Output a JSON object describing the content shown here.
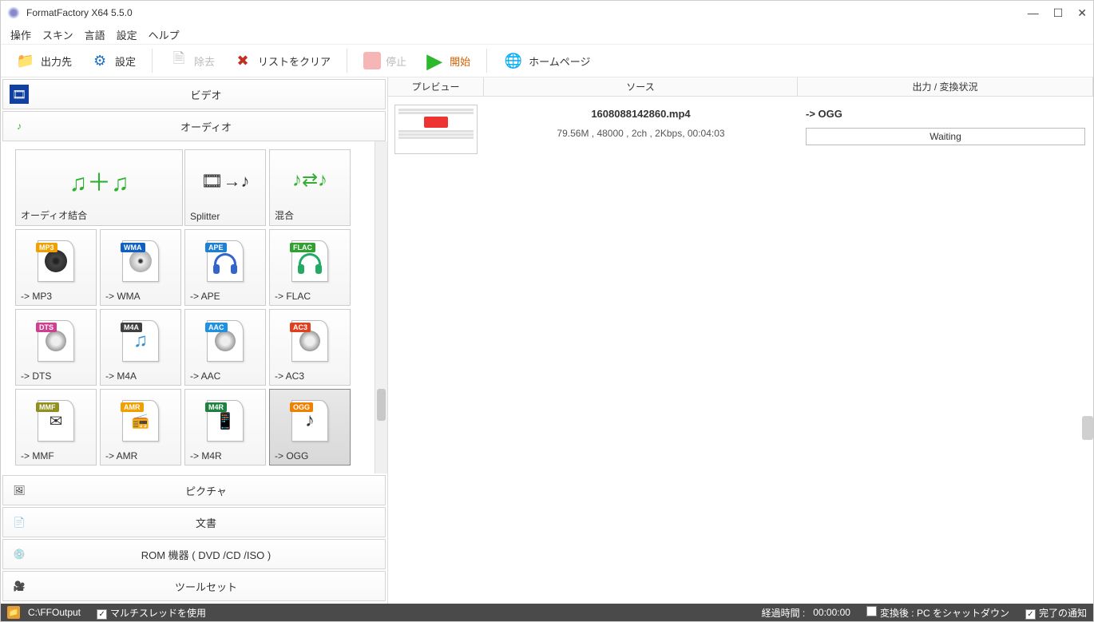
{
  "window": {
    "title": "FormatFactory X64 5.5.0"
  },
  "menu": [
    "操作",
    "スキン",
    "言語",
    "設定",
    "ヘルプ"
  ],
  "toolbar": {
    "output": "出力先",
    "settings": "設定",
    "remove": "除去",
    "clear": "リストをクリア",
    "stop": "停止",
    "start": "開始",
    "home": "ホームページ"
  },
  "categories": {
    "video": "ビデオ",
    "audio": "オーディオ",
    "picture": "ピクチャ",
    "document": "文書",
    "rom": "ROM 機器 ( DVD /CD /ISO )",
    "toolset": "ツールセット"
  },
  "audio_tools": {
    "join": "オーディオ結合",
    "splitter": "Splitter",
    "mix": "混合"
  },
  "formats": {
    "mp3": {
      "tag": "MP3",
      "label": "-> MP3",
      "color": "#f0a000"
    },
    "wma": {
      "tag": "WMA",
      "label": "-> WMA",
      "color": "#1060c0"
    },
    "ape": {
      "tag": "APE",
      "label": "-> APE",
      "color": "#2080d0"
    },
    "flac": {
      "tag": "FLAC",
      "label": "-> FLAC",
      "color": "#30a030"
    },
    "dts": {
      "tag": "DTS",
      "label": "-> DTS",
      "color": "#d04090"
    },
    "m4a": {
      "tag": "M4A",
      "label": "-> M4A",
      "color": "#404040"
    },
    "aac": {
      "tag": "AAC",
      "label": "-> AAC",
      "color": "#2090e0"
    },
    "ac3": {
      "tag": "AC3",
      "label": "-> AC3",
      "color": "#e04020"
    },
    "mmf": {
      "tag": "MMF",
      "label": "-> MMF",
      "color": "#909020"
    },
    "amr": {
      "tag": "AMR",
      "label": "-> AMR",
      "color": "#f0a000"
    },
    "m4r": {
      "tag": "M4R",
      "label": "-> M4R",
      "color": "#208040"
    },
    "ogg": {
      "tag": "OGG",
      "label": "-> OGG",
      "color": "#f08000"
    }
  },
  "list": {
    "cols": {
      "preview": "プレビュー",
      "source": "ソース",
      "status": "出力 / 変換状況"
    },
    "item": {
      "name": "1608088142860.mp4",
      "meta": "79.56M , 48000 , 2ch , 2Kbps, 00:04:03",
      "target": "-> OGG",
      "state": "Waiting"
    }
  },
  "status": {
    "path": "C:\\FFOutput",
    "multithread": "マルチスレッドを使用",
    "elapsed_label": "経過時間 :",
    "elapsed_value": "00:00:00",
    "shutdown": "変換後 : PC をシャットダウン",
    "notify": "完了の通知"
  }
}
